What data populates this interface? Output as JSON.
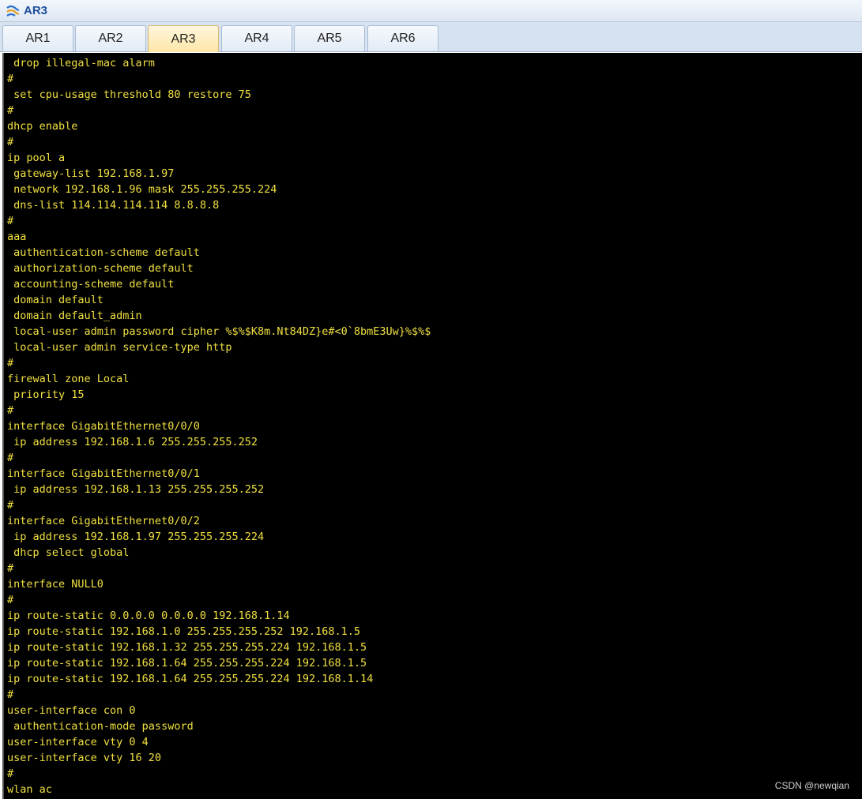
{
  "window": {
    "title": "AR3",
    "icon": "router-app-icon"
  },
  "tabs": [
    {
      "label": "AR1",
      "active": false
    },
    {
      "label": "AR2",
      "active": false
    },
    {
      "label": "AR3",
      "active": true
    },
    {
      "label": "AR4",
      "active": false
    },
    {
      "label": "AR5",
      "active": false
    },
    {
      "label": "AR6",
      "active": false
    }
  ],
  "terminal": {
    "background": "#000000",
    "text_color": "#f0e040",
    "lines": [
      " drop illegal-mac alarm",
      "#",
      " set cpu-usage threshold 80 restore 75",
      "#",
      "dhcp enable",
      "#",
      "ip pool a",
      " gateway-list 192.168.1.97",
      " network 192.168.1.96 mask 255.255.255.224",
      " dns-list 114.114.114.114 8.8.8.8",
      "#",
      "aaa",
      " authentication-scheme default",
      " authorization-scheme default",
      " accounting-scheme default",
      " domain default",
      " domain default_admin",
      " local-user admin password cipher %$%$K8m.Nt84DZ}e#<0`8bmE3Uw}%$%$",
      " local-user admin service-type http",
      "#",
      "firewall zone Local",
      " priority 15",
      "#",
      "interface GigabitEthernet0/0/0",
      " ip address 192.168.1.6 255.255.255.252",
      "#",
      "interface GigabitEthernet0/0/1",
      " ip address 192.168.1.13 255.255.255.252",
      "#",
      "interface GigabitEthernet0/0/2",
      " ip address 192.168.1.97 255.255.255.224",
      " dhcp select global",
      "#",
      "interface NULL0",
      "#",
      "ip route-static 0.0.0.0 0.0.0.0 192.168.1.14",
      "ip route-static 192.168.1.0 255.255.255.252 192.168.1.5",
      "ip route-static 192.168.1.32 255.255.255.224 192.168.1.5",
      "ip route-static 192.168.1.64 255.255.255.224 192.168.1.5",
      "ip route-static 192.168.1.64 255.255.255.224 192.168.1.14",
      "#",
      "user-interface con 0",
      " authentication-mode password",
      "user-interface vty 0 4",
      "user-interface vty 16 20",
      "#",
      "wlan ac"
    ]
  },
  "watermark": "CSDN @newqian"
}
